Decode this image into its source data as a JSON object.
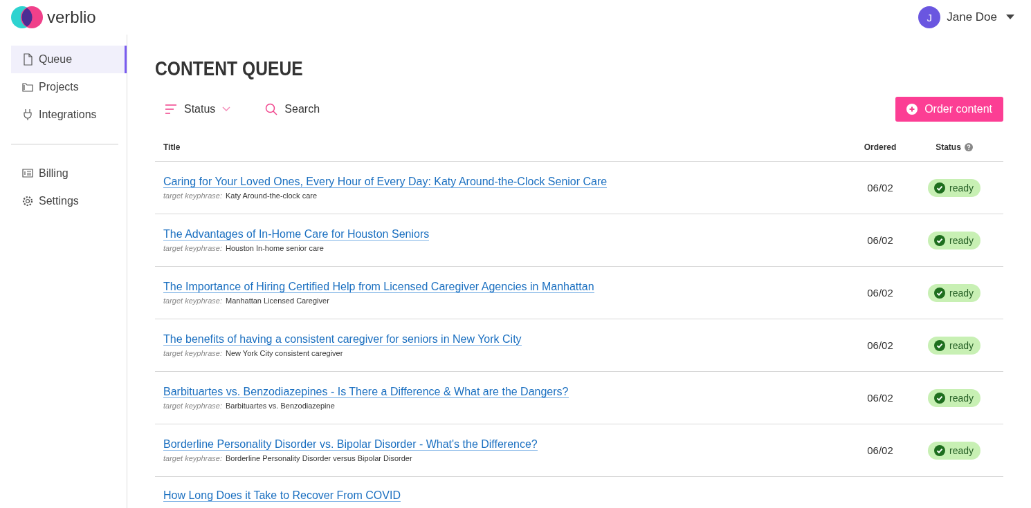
{
  "brand": {
    "name": "verblio"
  },
  "user": {
    "initial": "J",
    "name": "Jane Doe"
  },
  "sidebar": {
    "groups": [
      {
        "items": [
          {
            "label": "Queue",
            "selected": true
          },
          {
            "label": "Projects",
            "selected": false
          },
          {
            "label": "Integrations",
            "selected": false
          }
        ]
      },
      {
        "items": [
          {
            "label": "Billing",
            "selected": false
          },
          {
            "label": "Settings",
            "selected": false
          }
        ]
      }
    ]
  },
  "page": {
    "title": "CONTENT QUEUE"
  },
  "toolbar": {
    "filter": "Status",
    "search": {
      "placeholder": "Search"
    },
    "order_button": "Order content"
  },
  "table": {
    "columns": [
      "Title",
      "Ordered",
      "Status"
    ],
    "rows": [
      {
        "title": "Caring for Your Loved Ones, Every Hour of Every Day: Katy Around-the-Clock Senior Care",
        "keyphrase_label": "target keyphrase:",
        "keyphrase": "Katy Around-the-clock care",
        "ordered": "06/02",
        "status": {
          "kind": "ready",
          "label": "ready"
        }
      },
      {
        "title": "The Advantages of In-Home Care for Houston Seniors",
        "keyphrase_label": "target keyphrase:",
        "keyphrase": "Houston In-home senior care",
        "ordered": "06/02",
        "status": {
          "kind": "ready",
          "label": "ready"
        }
      },
      {
        "title": "The Importance of Hiring Certified Help from Licensed Caregiver Agencies in Manhattan",
        "keyphrase_label": "target keyphrase:",
        "keyphrase": "Manhattan Licensed Caregiver",
        "ordered": "06/02",
        "status": {
          "kind": "ready",
          "label": "ready"
        }
      },
      {
        "title": "The benefits of having a consistent caregiver for seniors in New York City",
        "keyphrase_label": "target keyphrase:",
        "keyphrase": "New York City consistent caregiver",
        "ordered": "06/02",
        "status": {
          "kind": "ready",
          "label": "ready"
        }
      },
      {
        "title": "Barbituartes vs. Benzodiazepines - Is There a Difference & What are the Dangers?",
        "keyphrase_label": "target keyphrase:",
        "keyphrase": "Barbituartes vs. Benzodiazepine",
        "ordered": "06/02",
        "status": {
          "kind": "ready",
          "label": "ready"
        }
      },
      {
        "title": "Borderline Personality Disorder vs. Bipolar Disorder - What's the Difference?",
        "keyphrase_label": "target keyphrase:",
        "keyphrase": "Borderline Personality Disorder versus Bipolar Disorder",
        "ordered": "06/02",
        "status": {
          "kind": "ready",
          "label": "ready"
        }
      },
      {
        "title": "How Long Does it Take to Recover From COVID"
      }
    ]
  }
}
